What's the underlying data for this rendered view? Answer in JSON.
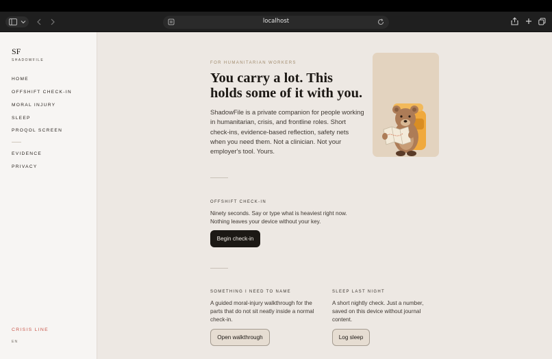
{
  "browser": {
    "url": "localhost",
    "icons": [
      "sidebar-icon",
      "chevron-down-icon",
      "back-icon",
      "forward-icon",
      "site-settings-icon",
      "reload-icon",
      "share-icon",
      "plus-icon",
      "tabs-icon"
    ]
  },
  "sidebar": {
    "logo": "SF",
    "brand": "SHADOWFILE",
    "nav": [
      {
        "label": "HOME"
      },
      {
        "label": "OFFSHIFT CHECK-IN"
      },
      {
        "label": "MORAL INJURY"
      },
      {
        "label": "SLEEP"
      },
      {
        "label": "PROQOL SCREEN"
      }
    ],
    "nav_secondary": [
      {
        "label": "EVIDENCE"
      },
      {
        "label": "PRIVACY"
      }
    ],
    "crisis": "CRISIS LINE",
    "lang": "EN"
  },
  "hero": {
    "eyebrow": "FOR HUMANITARIAN WORKERS",
    "title": "You carry a lot. This holds some of it with you.",
    "body": "ShadowFile is a private companion for people working in humanitarian, crisis, and frontline roles. Short check-ins, evidence-based reflection, safety nets when you need them. Not a clinician. Not your employer's tool. Yours."
  },
  "checkin": {
    "label": "OFFSHIFT CHECK-IN",
    "body": "Ninety seconds. Say or type what is heaviest right now. Nothing leaves your device without your key.",
    "button": "Begin check-in"
  },
  "moral": {
    "label": "SOMETHING I NEED TO NAME",
    "body": "A guided moral-injury walkthrough for the parts that do not sit neatly inside a normal check-in.",
    "button": "Open walkthrough"
  },
  "sleep": {
    "label": "SLEEP LAST NIGHT",
    "body": "A short nightly check. Just a number, saved on this device without journal content.",
    "button": "Log sleep"
  },
  "colors": {
    "accent_crisis": "#c9574b",
    "background": "#ede8e3",
    "primary_button": "#1c1915"
  }
}
